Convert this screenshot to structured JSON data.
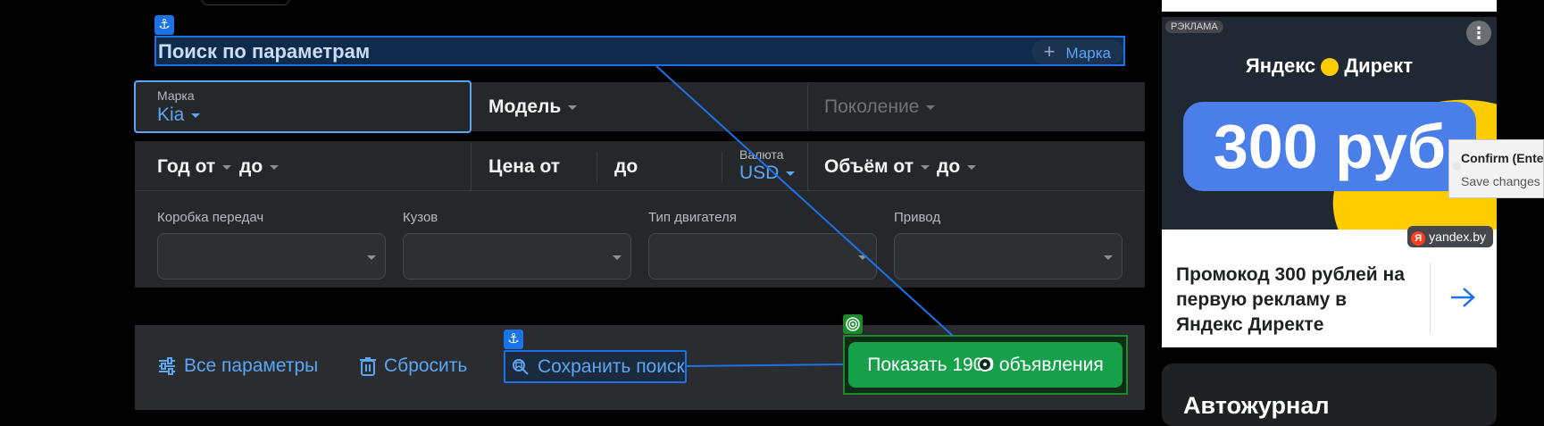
{
  "search": {
    "title": "Поиск по параметрам",
    "brand_chip": "Марка",
    "brand_label": "Марка",
    "brand_value": "Kia",
    "model": "Модель",
    "generation": "Поколение",
    "year_from": "Год от",
    "year_to": "до",
    "price_from": "Цена от",
    "price_to": "до",
    "currency_label": "Валюта",
    "currency_value": "USD",
    "volume_from": "Объём от",
    "volume_to": "до",
    "gearbox": "Коробка передач",
    "body": "Кузов",
    "engine": "Тип двигателя",
    "drive": "Привод",
    "all_params": "Все параметры",
    "reset": "Сбросить",
    "save_search": "Сохранить поиск",
    "show_results": "Показать 1900 объявления"
  },
  "overlay": {
    "anchor_glyph": "⚓",
    "target_glyph": "◎"
  },
  "ad": {
    "badge": "РЭКЛАМА",
    "logo_text": "Яндекс",
    "logo_text2": "Директ",
    "amount": "300 руб",
    "source_badge_letter": "Я",
    "source": "yandex.by",
    "headline": "Промокод 300 рублей на первую рекламу в Яндекс Директе"
  },
  "tooltip": {
    "title": "Confirm (Ente",
    "subtitle": "Save changes"
  },
  "footer_card": {
    "title": "Автожурнал"
  },
  "colors": {
    "accent_blue": "#5ba6f5",
    "green_button": "#16a04a",
    "panel": "#26272b",
    "background": "#000000"
  }
}
